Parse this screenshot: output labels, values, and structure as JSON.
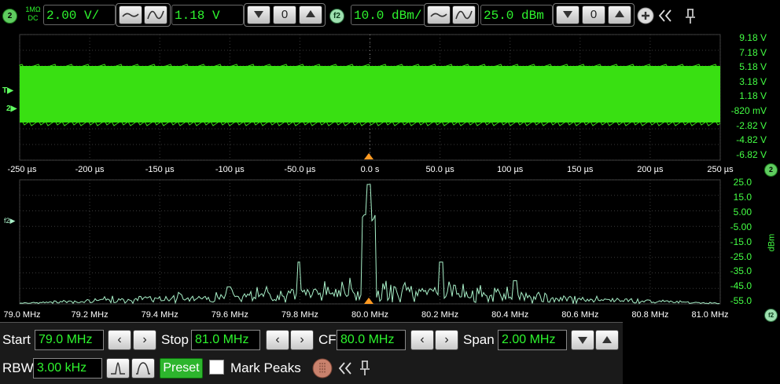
{
  "topbar": {
    "ch2_badge": "2",
    "coupling_top": "1MΩ",
    "coupling_bottom": "DC",
    "ch2_scale": "2.00 V/",
    "ch2_offset": "1.18 V",
    "offset_reset": "0",
    "f2_badge": "f2",
    "f2_scale": "10.0 dBm/",
    "f2_offset": "25.0 dBm",
    "f2_reset": "0",
    "add_icon": "plus-circle-icon",
    "collapse_icon": "double-chevron-left-icon",
    "pin_icon": "pin-icon"
  },
  "time_plot": {
    "trigger_marker": "T",
    "ch_marker": "2",
    "y_labels": [
      "9.18 V",
      "7.18 V",
      "5.18 V",
      "3.18 V",
      "1.18 V",
      "-820 mV",
      "-2.82 V",
      "-4.82 V",
      "-6.82 V"
    ],
    "x_labels": [
      "-250 µs",
      "-200 µs",
      "-150 µs",
      "-100 µs",
      "-50.0 µs",
      "0.0 s",
      "50.0 µs",
      "100 µs",
      "150 µs",
      "200 µs",
      "250 µs"
    ],
    "badge": "2",
    "signal_color": "#39e012"
  },
  "spectrum_plot": {
    "marker": "f2",
    "y_labels": [
      "25.0",
      "15.0",
      "5.00",
      "-5.00",
      "-15.0",
      "-25.0",
      "-35.0",
      "-45.0",
      "-55.0"
    ],
    "y_unit": "dBm",
    "x_labels": [
      "79.0 MHz",
      "79.2 MHz",
      "79.4 MHz",
      "79.6 MHz",
      "79.8 MHz",
      "80.0 MHz",
      "80.2 MHz",
      "80.4 MHz",
      "80.6 MHz",
      "80.8 MHz",
      "81.0 MHz"
    ],
    "badge": "f2",
    "trace_color": "#a8f0c8"
  },
  "fft_controls": {
    "start_label": "Start",
    "start_value": "79.0 MHz",
    "stop_label": "Stop",
    "stop_value": "81.0 MHz",
    "cf_label": "CF",
    "cf_value": "80.0 MHz",
    "span_label": "Span",
    "span_value": "2.00 MHz",
    "rbw_label": "RBW",
    "rbw_value": "3.00 kHz",
    "preset_label": "Preset",
    "mark_peaks_label": "Mark Peaks",
    "mark_peaks_checked": false,
    "left_arrow": "‹",
    "right_arrow": "›"
  }
}
